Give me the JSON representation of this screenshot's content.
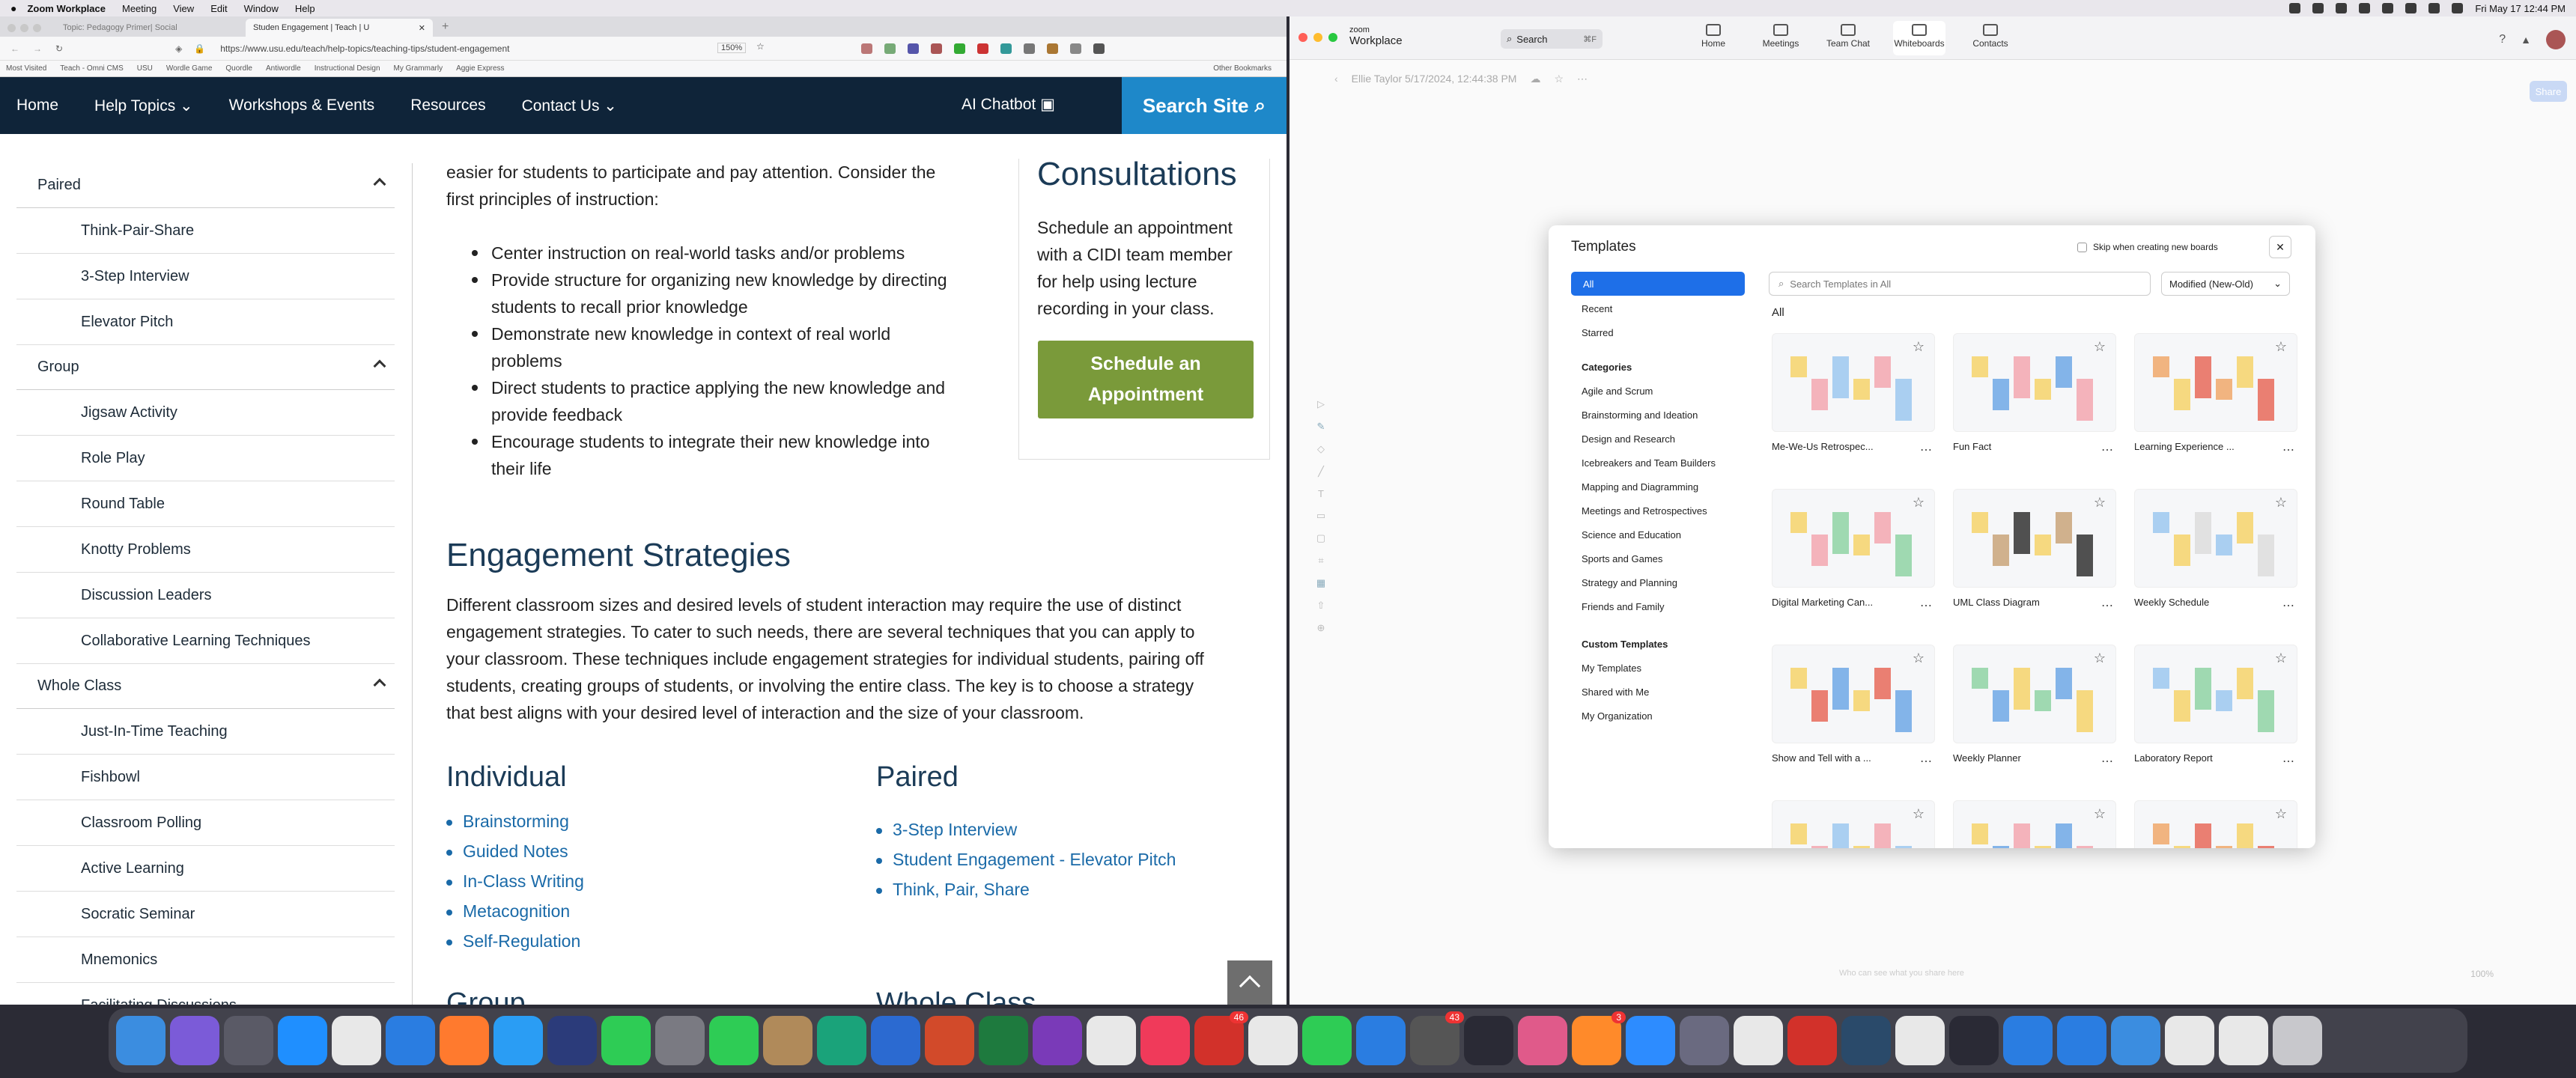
{
  "menubar": {
    "app_name": "Zoom Workplace",
    "menus": [
      "Meeting",
      "View",
      "Edit",
      "Window",
      "Help"
    ],
    "datetime": "Fri May 17  12:44 PM"
  },
  "browser": {
    "tabs": [
      "Topic: Pedagogy Primer| Social",
      "Studen Engagement | Teach | U"
    ],
    "url": "https://www.usu.edu/teach/help-topics/teaching-tips/student-engagement",
    "zoom": "150%",
    "bookmarks": [
      "Most Visited",
      "Teach - Omni CMS",
      "USU",
      "Wordle Game",
      "Quordle",
      "Antiwordle",
      "Instructional Design",
      "My Grammarly",
      "Aggie Express"
    ],
    "other_bookmarks": "Other Bookmarks"
  },
  "site_nav": {
    "items": [
      "Home",
      "Help Topics",
      "Workshops & Events",
      "Resources",
      "Contact Us"
    ],
    "chatbot": "AI Chatbot",
    "search": "Search Site"
  },
  "sidebar": {
    "paired_label": "Paired",
    "paired_items": [
      "Think-Pair-Share",
      "3-Step Interview",
      "Elevator Pitch"
    ],
    "group_label": "Group",
    "group_items": [
      "Jigsaw Activity",
      "Role Play",
      "Round Table",
      "Knotty Problems",
      "Discussion Leaders",
      "Collaborative Learning Techniques"
    ],
    "whole_label": "Whole Class",
    "whole_items": [
      "Just-In-Time Teaching",
      "Fishbowl",
      "Classroom Polling",
      "Active Learning",
      "Socratic Seminar",
      "Mnemonics",
      "Facilitating Discussions"
    ]
  },
  "content": {
    "intro_line1": "easier for students to participate and pay attention. Consider the",
    "intro_line2": "first principles of instruction:",
    "principles": [
      "Center instruction on real-world tasks and/or problems",
      "Provide structure for organizing new knowledge by directing",
      "students to recall prior knowledge",
      "Demonstrate new knowledge in context of real world",
      "problems",
      "Direct students to practice applying the new knowledge and",
      "provide feedback",
      "Encourage students to integrate their new knowledge into",
      "their life"
    ],
    "strategies_heading": "Engagement Strategies",
    "strategies_lines": [
      "Different classroom sizes and desired levels of student interaction may require the use of distinct",
      "engagement strategies. To cater to such needs, there are several techniques that you can apply to",
      "your classroom. These techniques include engagement strategies for individual students, pairing off",
      "students, creating groups of students, or involving the entire class. The key is to choose a strategy",
      "that best aligns with your desired level of interaction and the size of your classroom."
    ],
    "individual_heading": "Individual",
    "individual_links": [
      "Brainstorming",
      "Guided Notes",
      "In-Class Writing",
      "Metacognition",
      "Self-Regulation"
    ],
    "paired_heading": "Paired",
    "paired_links": [
      "3-Step Interview",
      "Student Engagement - Elevator Pitch",
      "Think, Pair, Share"
    ],
    "group_heading": "Group",
    "whole_heading": "Whole Class"
  },
  "consult": {
    "heading": "Consultations",
    "lines": [
      "Schedule an appointment",
      "with a CIDI team member",
      "for help using lecture",
      "recording in your class."
    ],
    "button_line1": "Schedule an",
    "button_line2": "Appointment"
  },
  "zoom": {
    "brand_top": "zoom",
    "brand_bottom": "Workplace",
    "search_label": "Search",
    "search_shortcut": "⌘F",
    "tabs": [
      "Home",
      "Meetings",
      "Team Chat",
      "Whiteboards",
      "Contacts"
    ],
    "whiteboard_title": "Ellie Taylor 5/17/2024, 12:44:38 PM",
    "share": "Share",
    "zoom_pct": "100%",
    "ask_placeholder": "Who can see what you share here"
  },
  "templates": {
    "title": "Templates",
    "skip_label": "Skip when creating new boards",
    "nav": [
      "All",
      "Recent",
      "Starred"
    ],
    "categories_label": "Categories",
    "categories": [
      "Agile and Scrum",
      "Brainstorming and Ideation",
      "Design and Research",
      "Icebreakers and Team Builders",
      "Mapping and Diagramming",
      "Meetings and Retrospectives",
      "Science and Education",
      "Sports and Games",
      "Strategy and Planning",
      "Friends and Family"
    ],
    "custom_label": "Custom Templates",
    "custom": [
      "My Templates",
      "Shared with Me",
      "My Organization"
    ],
    "search_placeholder": "Search Templates in All",
    "sort": "Modified (New-Old)",
    "section": "All",
    "cards": [
      "Me-We-Us Retrospec...",
      "Fun Fact",
      "Learning Experience ...",
      "Digital Marketing Can...",
      "UML Class Diagram",
      "Weekly Schedule",
      "Show and Tell with a ...",
      "Weekly Planner",
      "Laboratory Report"
    ]
  },
  "dock": {
    "badges": [
      "46",
      "43",
      "3"
    ]
  }
}
